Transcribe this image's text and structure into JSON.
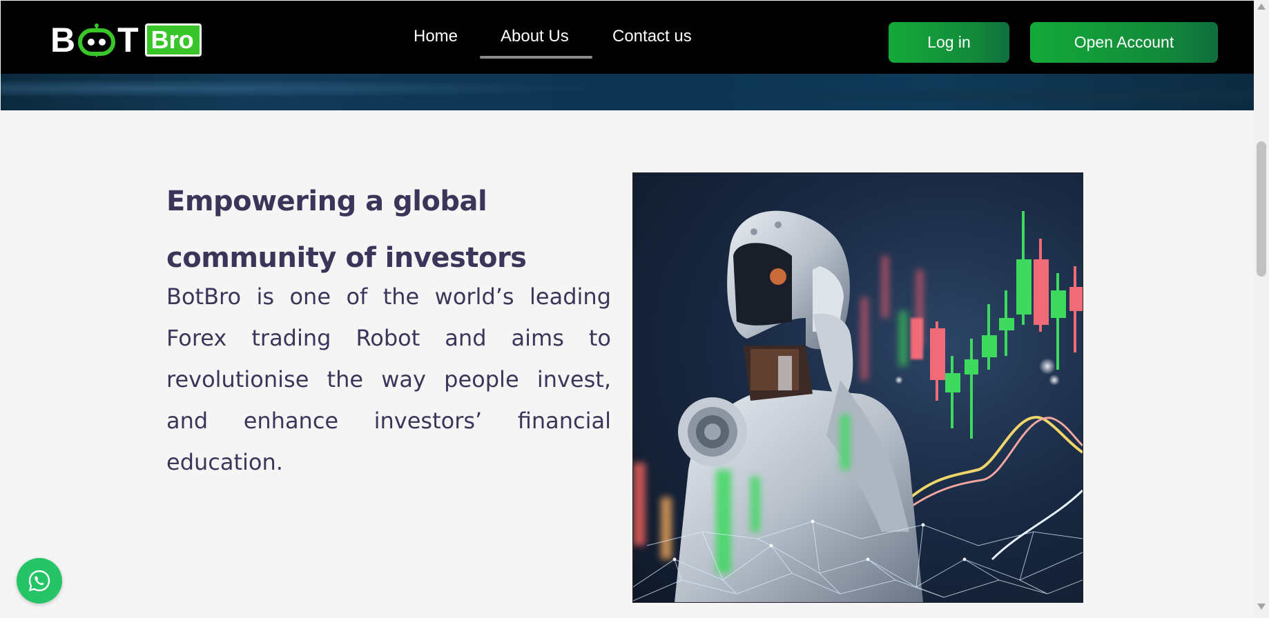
{
  "brand": {
    "name_part1": "B",
    "name_part2": "T",
    "name_badge": "Bro",
    "accent_color": "#39c62a"
  },
  "nav": {
    "items": [
      {
        "label": "Home",
        "active": false
      },
      {
        "label": "About Us",
        "active": true
      },
      {
        "label": "Contact us",
        "active": false
      }
    ]
  },
  "actions": {
    "login_label": "Log in",
    "open_account_label": "Open Account"
  },
  "main": {
    "headline_line1": "Empowering a global",
    "headline_line2": "community of investors",
    "body": "BotBro is one of the world’s leading Forex trading Robot and aims to revolutionise the way people invest, and enhance investors’ financial education."
  },
  "hero_image": {
    "description_icon": "robot-trading-chart-image"
  },
  "floating": {
    "whatsapp_icon": "whatsapp-icon"
  },
  "colors": {
    "header_bg": "#000000",
    "button_green": "#14a93a",
    "text_dark": "#3b3659",
    "whatsapp_green": "#25c466"
  }
}
